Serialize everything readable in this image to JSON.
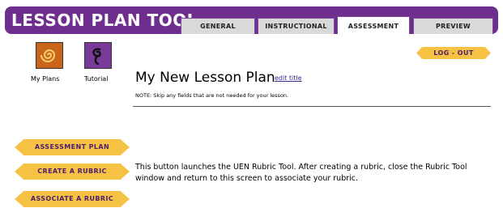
{
  "header": {
    "app_title": "LESSON PLAN TOOL",
    "tabs": [
      {
        "label": "GENERAL",
        "active": false
      },
      {
        "label": "INSTRUCTIONAL",
        "active": false
      },
      {
        "label": "ASSESSMENT",
        "active": true
      },
      {
        "label": "PREVIEW",
        "active": false
      }
    ]
  },
  "shortcuts": {
    "my_plans": {
      "label": "My Plans",
      "icon": "spiral-icon"
    },
    "tutorial": {
      "label": "Tutorial",
      "icon": "swirl-icon"
    }
  },
  "logout_label": "LOG - OUT",
  "lesson": {
    "title": "My New Lesson Plan",
    "edit_title_link": "edit title",
    "note": "NOTE: Skip any fields that are not needed for your lesson."
  },
  "side_buttons": {
    "assessment_plan": "ASSESSMENT PLAN",
    "create_rubric": "CREATE A RUBRIC",
    "associate_rubric": "ASSOCIATE A RUBRIC"
  },
  "description": "This button launches the UEN Rubric Tool. After creating a rubric, close the Rubric Tool window and return to this screen to associate your rubric.",
  "colors": {
    "brand_purple": "#6e2e8e",
    "button_gold": "#f6c244",
    "button_text": "#4b1f6e"
  }
}
